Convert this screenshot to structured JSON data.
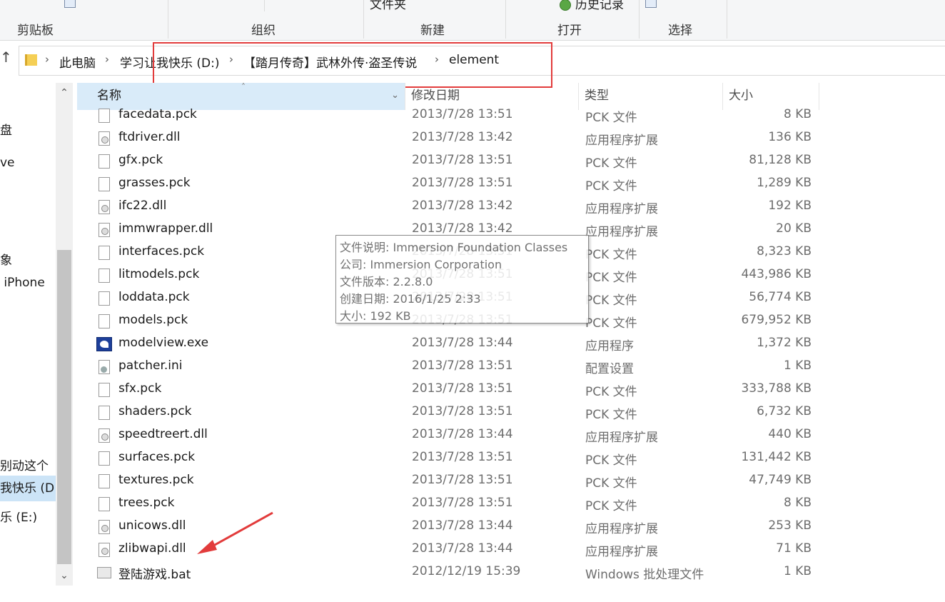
{
  "ribbon": {
    "top_items": [
      "文件夹",
      "历史记录"
    ],
    "groups": [
      "剪贴板",
      "组织",
      "新建",
      "打开",
      "选择"
    ]
  },
  "address": {
    "up_glyph": "↑",
    "breadcrumbs": [
      "此电脑",
      "学习让我快乐 (D:)",
      "【踏月传奇】武林外传·盗圣传说",
      "element"
    ]
  },
  "navpane": {
    "items": [
      "盘",
      "ve",
      "象",
      "iPhone",
      "别动这个",
      "我快乐 (D",
      "乐 (E:)"
    ],
    "selected_index": 5
  },
  "columns": {
    "name": "名称",
    "date": "修改日期",
    "type": "类型",
    "size": "大小"
  },
  "files": [
    {
      "name": "facedata.pck",
      "date": "2013/7/28 13:51",
      "type": "PCK 文件",
      "size": "8 KB",
      "icon": "file-icon"
    },
    {
      "name": "ftdriver.dll",
      "date": "2013/7/28 13:42",
      "type": "应用程序扩展",
      "size": "136 KB",
      "icon": "dll-icon"
    },
    {
      "name": "gfx.pck",
      "date": "2013/7/28 13:51",
      "type": "PCK 文件",
      "size": "81,128 KB",
      "icon": "file-icon"
    },
    {
      "name": "grasses.pck",
      "date": "2013/7/28 13:51",
      "type": "PCK 文件",
      "size": "1,289 KB",
      "icon": "file-icon"
    },
    {
      "name": "ifc22.dll",
      "date": "2013/7/28 13:42",
      "type": "应用程序扩展",
      "size": "192 KB",
      "icon": "dll-icon"
    },
    {
      "name": "immwrapper.dll",
      "date": "2013/7/28 13:42",
      "type": "应用程序扩展",
      "size": "20 KB",
      "icon": "dll-icon"
    },
    {
      "name": "interfaces.pck",
      "date": "2013/7/28 13:51",
      "type": "PCK 文件",
      "size": "8,323 KB",
      "icon": "file-icon"
    },
    {
      "name": "litmodels.pck",
      "date": "2013/7/28 13:51",
      "type": "PCK 文件",
      "size": "443,986 KB",
      "icon": "file-icon"
    },
    {
      "name": "loddata.pck",
      "date": "2013/7/28 13:51",
      "type": "PCK 文件",
      "size": "56,774 KB",
      "icon": "file-icon"
    },
    {
      "name": "models.pck",
      "date": "2013/7/28 13:51",
      "type": "PCK 文件",
      "size": "679,952 KB",
      "icon": "file-icon"
    },
    {
      "name": "modelview.exe",
      "date": "2013/7/28 13:44",
      "type": "应用程序",
      "size": "1,372 KB",
      "icon": "exe-icon"
    },
    {
      "name": "patcher.ini",
      "date": "2013/7/28 13:51",
      "type": "配置设置",
      "size": "1 KB",
      "icon": "ini-icon"
    },
    {
      "name": "sfx.pck",
      "date": "2013/7/28 13:51",
      "type": "PCK 文件",
      "size": "333,788 KB",
      "icon": "file-icon"
    },
    {
      "name": "shaders.pck",
      "date": "2013/7/28 13:51",
      "type": "PCK 文件",
      "size": "6,732 KB",
      "icon": "file-icon"
    },
    {
      "name": "speedtreert.dll",
      "date": "2013/7/28 13:44",
      "type": "应用程序扩展",
      "size": "440 KB",
      "icon": "dll-icon"
    },
    {
      "name": "surfaces.pck",
      "date": "2013/7/28 13:51",
      "type": "PCK 文件",
      "size": "131,442 KB",
      "icon": "file-icon"
    },
    {
      "name": "textures.pck",
      "date": "2013/7/28 13:51",
      "type": "PCK 文件",
      "size": "47,749 KB",
      "icon": "file-icon"
    },
    {
      "name": "trees.pck",
      "date": "2013/7/28 13:51",
      "type": "PCK 文件",
      "size": "8 KB",
      "icon": "file-icon"
    },
    {
      "name": "unicows.dll",
      "date": "2013/7/28 13:44",
      "type": "应用程序扩展",
      "size": "253 KB",
      "icon": "dll-icon"
    },
    {
      "name": "zlibwapi.dll",
      "date": "2013/7/28 13:44",
      "type": "应用程序扩展",
      "size": "71 KB",
      "icon": "dll-icon"
    },
    {
      "name": "登陆游戏.bat",
      "date": "2012/12/19 15:39",
      "type": "Windows 批处理文件",
      "size": "1 KB",
      "icon": "bat-icon"
    }
  ],
  "tooltip": {
    "lines": [
      "文件说明: Immersion Foundation Classes",
      "公司: Immersion Corporation",
      "文件版本: 2.2.8.0",
      "创建日期: 2016/1/25 2:33",
      "大小: 192 KB"
    ]
  },
  "colors": {
    "annotation_red": "#e23b3b",
    "header_selected": "#d9ebf9",
    "nav_selected": "#cce4f7"
  }
}
